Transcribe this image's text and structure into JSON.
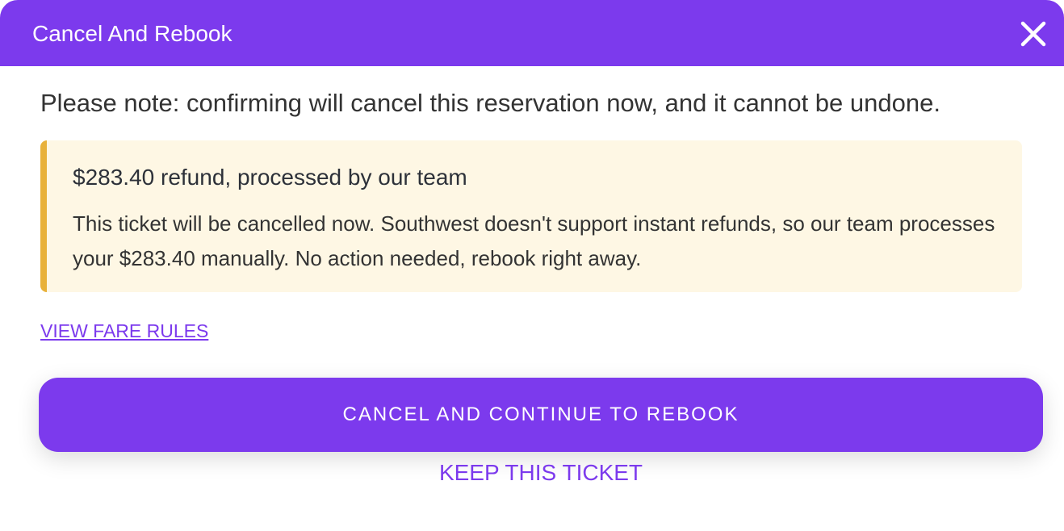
{
  "modal": {
    "title": "Cancel And Rebook",
    "close_icon": "close-icon"
  },
  "note": "Please note: confirming will cancel this reservation now, and it cannot be undone.",
  "refund_notice": {
    "title": "$283.40 refund, processed by our team",
    "body": "This ticket will be cancelled now. Southwest doesn't support instant refunds, so our team processes your $283.40 manually. No action needed, rebook right away.",
    "accent_color": "#e8b13a",
    "background_color": "#fef7e4"
  },
  "links": {
    "fare_rules": "VIEW FARE RULES"
  },
  "actions": {
    "primary_label": "CANCEL AND CONTINUE TO REBOOK",
    "secondary_label": "KEEP THIS TICKET"
  },
  "colors": {
    "brand": "#7c3aed"
  }
}
